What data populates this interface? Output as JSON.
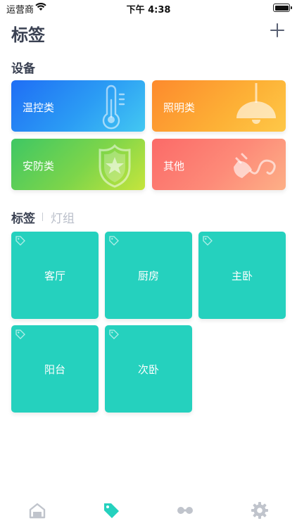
{
  "status_bar": {
    "carrier": "运营商",
    "time": "下午 4:38"
  },
  "header": {
    "title": "标签"
  },
  "devices": {
    "section_title": "设备",
    "items": [
      {
        "label": "温控类",
        "icon": "thermometer-icon"
      },
      {
        "label": "照明类",
        "icon": "lamp-icon"
      },
      {
        "label": "安防类",
        "icon": "shield-star-icon"
      },
      {
        "label": "其他",
        "icon": "plug-icon"
      }
    ]
  },
  "tags": {
    "tabs": [
      {
        "label": "标签",
        "active": true
      },
      {
        "label": "灯组",
        "active": false
      }
    ],
    "items": [
      {
        "label": "客厅"
      },
      {
        "label": "厨房"
      },
      {
        "label": "主卧"
      },
      {
        "label": "阳台"
      },
      {
        "label": "次卧"
      }
    ]
  },
  "tab_bar": {
    "items": [
      {
        "icon": "home-icon",
        "active": false
      },
      {
        "icon": "tag-icon",
        "active": true
      },
      {
        "icon": "link-icon",
        "active": false
      },
      {
        "icon": "settings-gear-icon",
        "active": false
      }
    ]
  },
  "colors": {
    "tile": "#25d1be",
    "active_tab": "#25d1be",
    "inactive_tab": "#c0c4cc",
    "text_dark": "#3a4152"
  }
}
